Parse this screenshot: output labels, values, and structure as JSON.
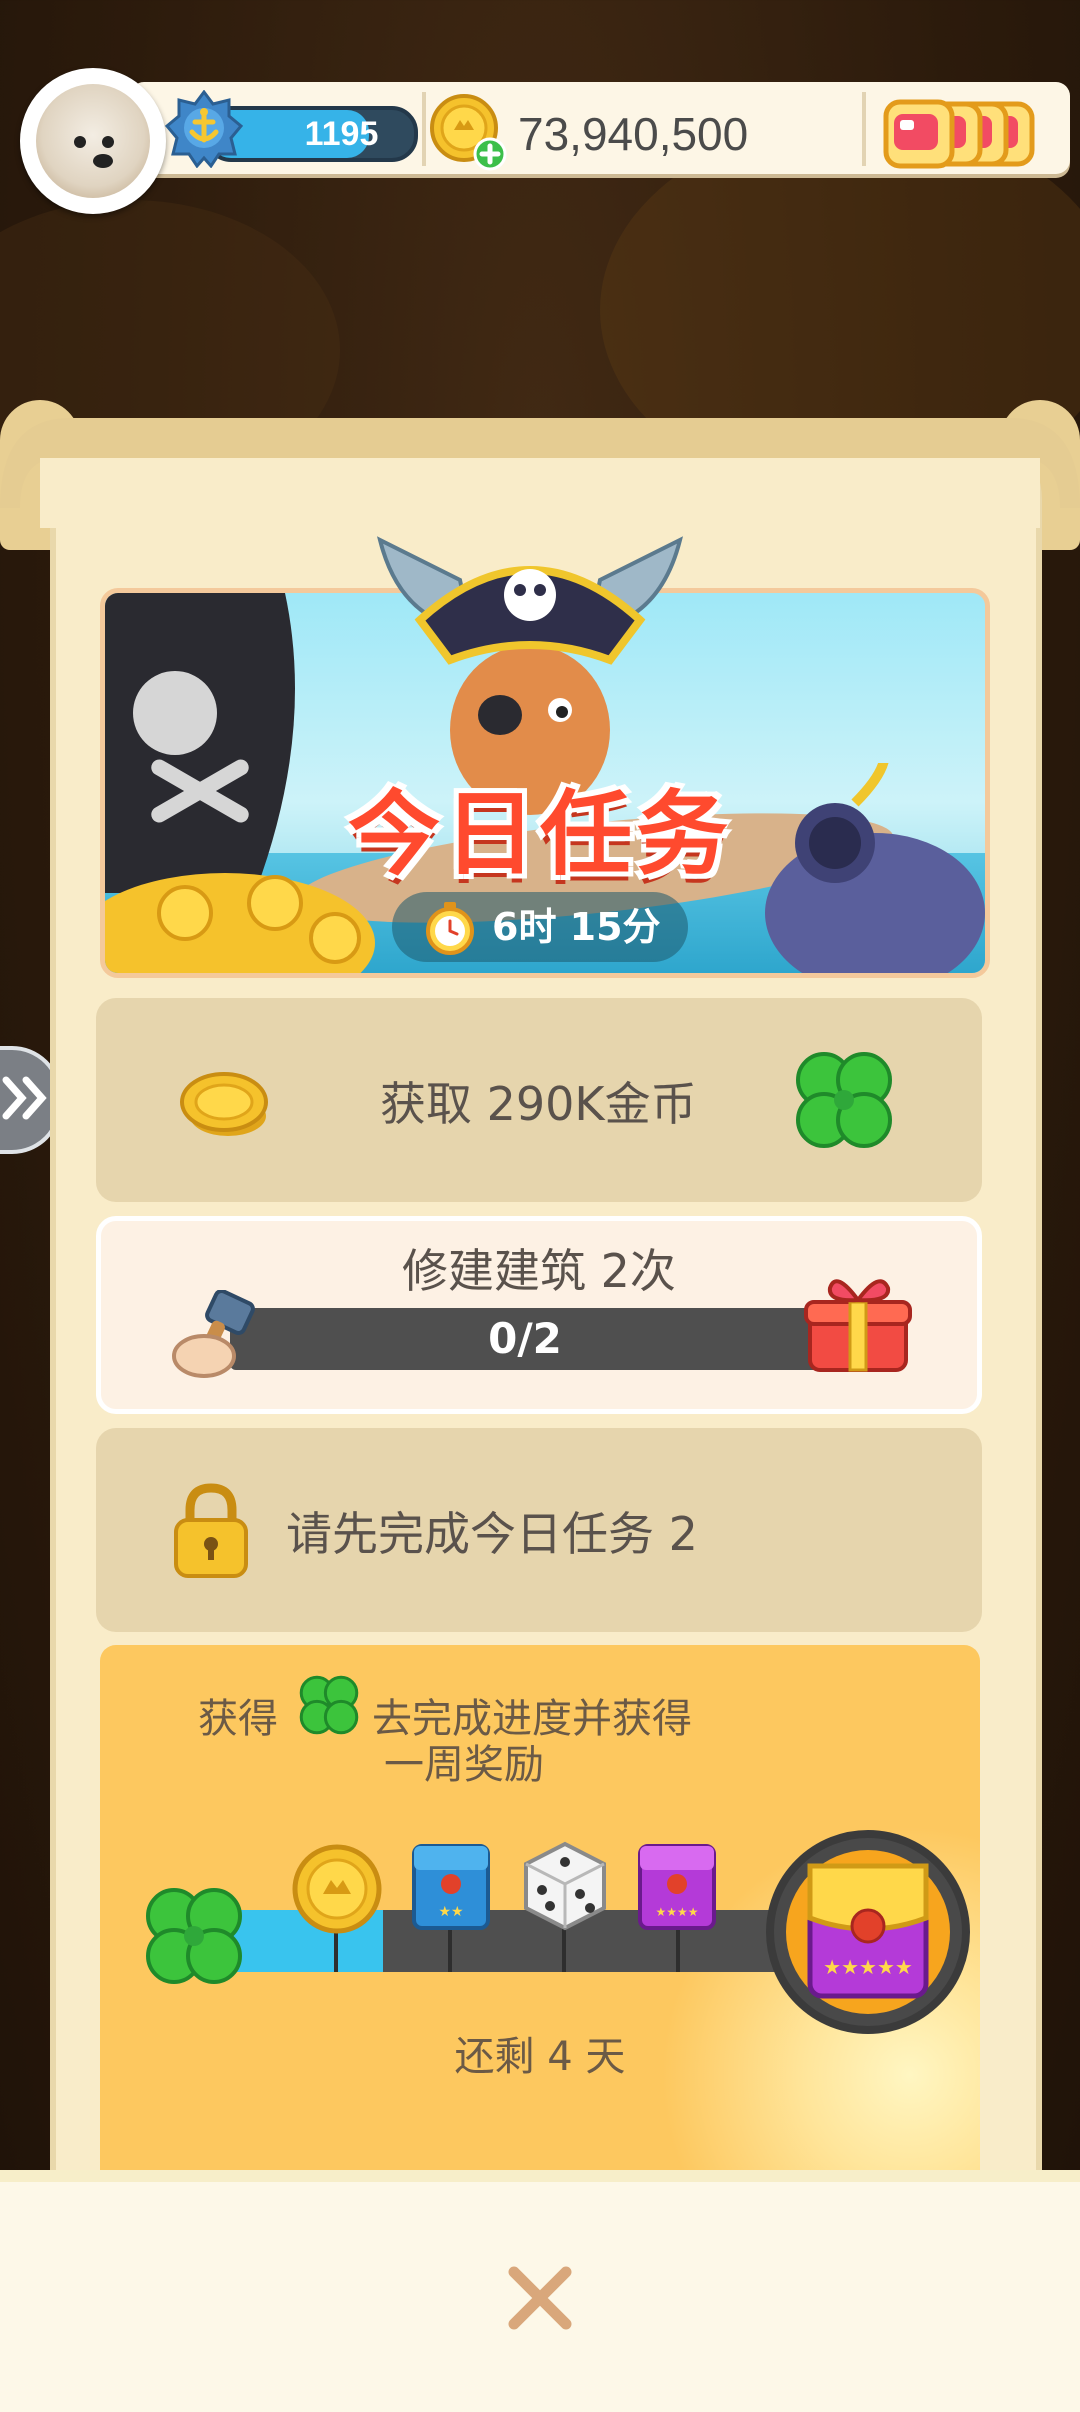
{
  "hud": {
    "level": "1195",
    "coins": "73,940,500",
    "level_progress": 0.78,
    "dice_cards": 4
  },
  "event": {
    "title": "今日任务",
    "timer": "6时 15分"
  },
  "tasks": [
    {
      "label": "获取 290K金币",
      "state": "completed",
      "reward_icon": "clover-icon"
    },
    {
      "label": "修建建筑 2次",
      "progress_text": "0/2",
      "progress": 0.0,
      "reward_icon": "gift-chest-icon",
      "state": "active"
    },
    {
      "label": "请先完成今日任务 2",
      "state": "locked",
      "icon": "padlock-icon"
    }
  ],
  "weekly": {
    "line1_pre": "获得",
    "line1_post": "去完成进度并获得",
    "line2": "一周奖励",
    "remaining": "还剩 4 天",
    "progress": 0.27,
    "rewards": [
      "gold-coin-icon",
      "blue-sticker-pack-icon",
      "dice-icon",
      "purple-sticker-pack-icon",
      "golden-sticker-pack-icon"
    ]
  },
  "colors": {
    "panel": "#f9ecc9",
    "title_red": "#ff4a2e",
    "progress_blue": "#39c4ee",
    "week_yellow": "#fdc85f"
  }
}
